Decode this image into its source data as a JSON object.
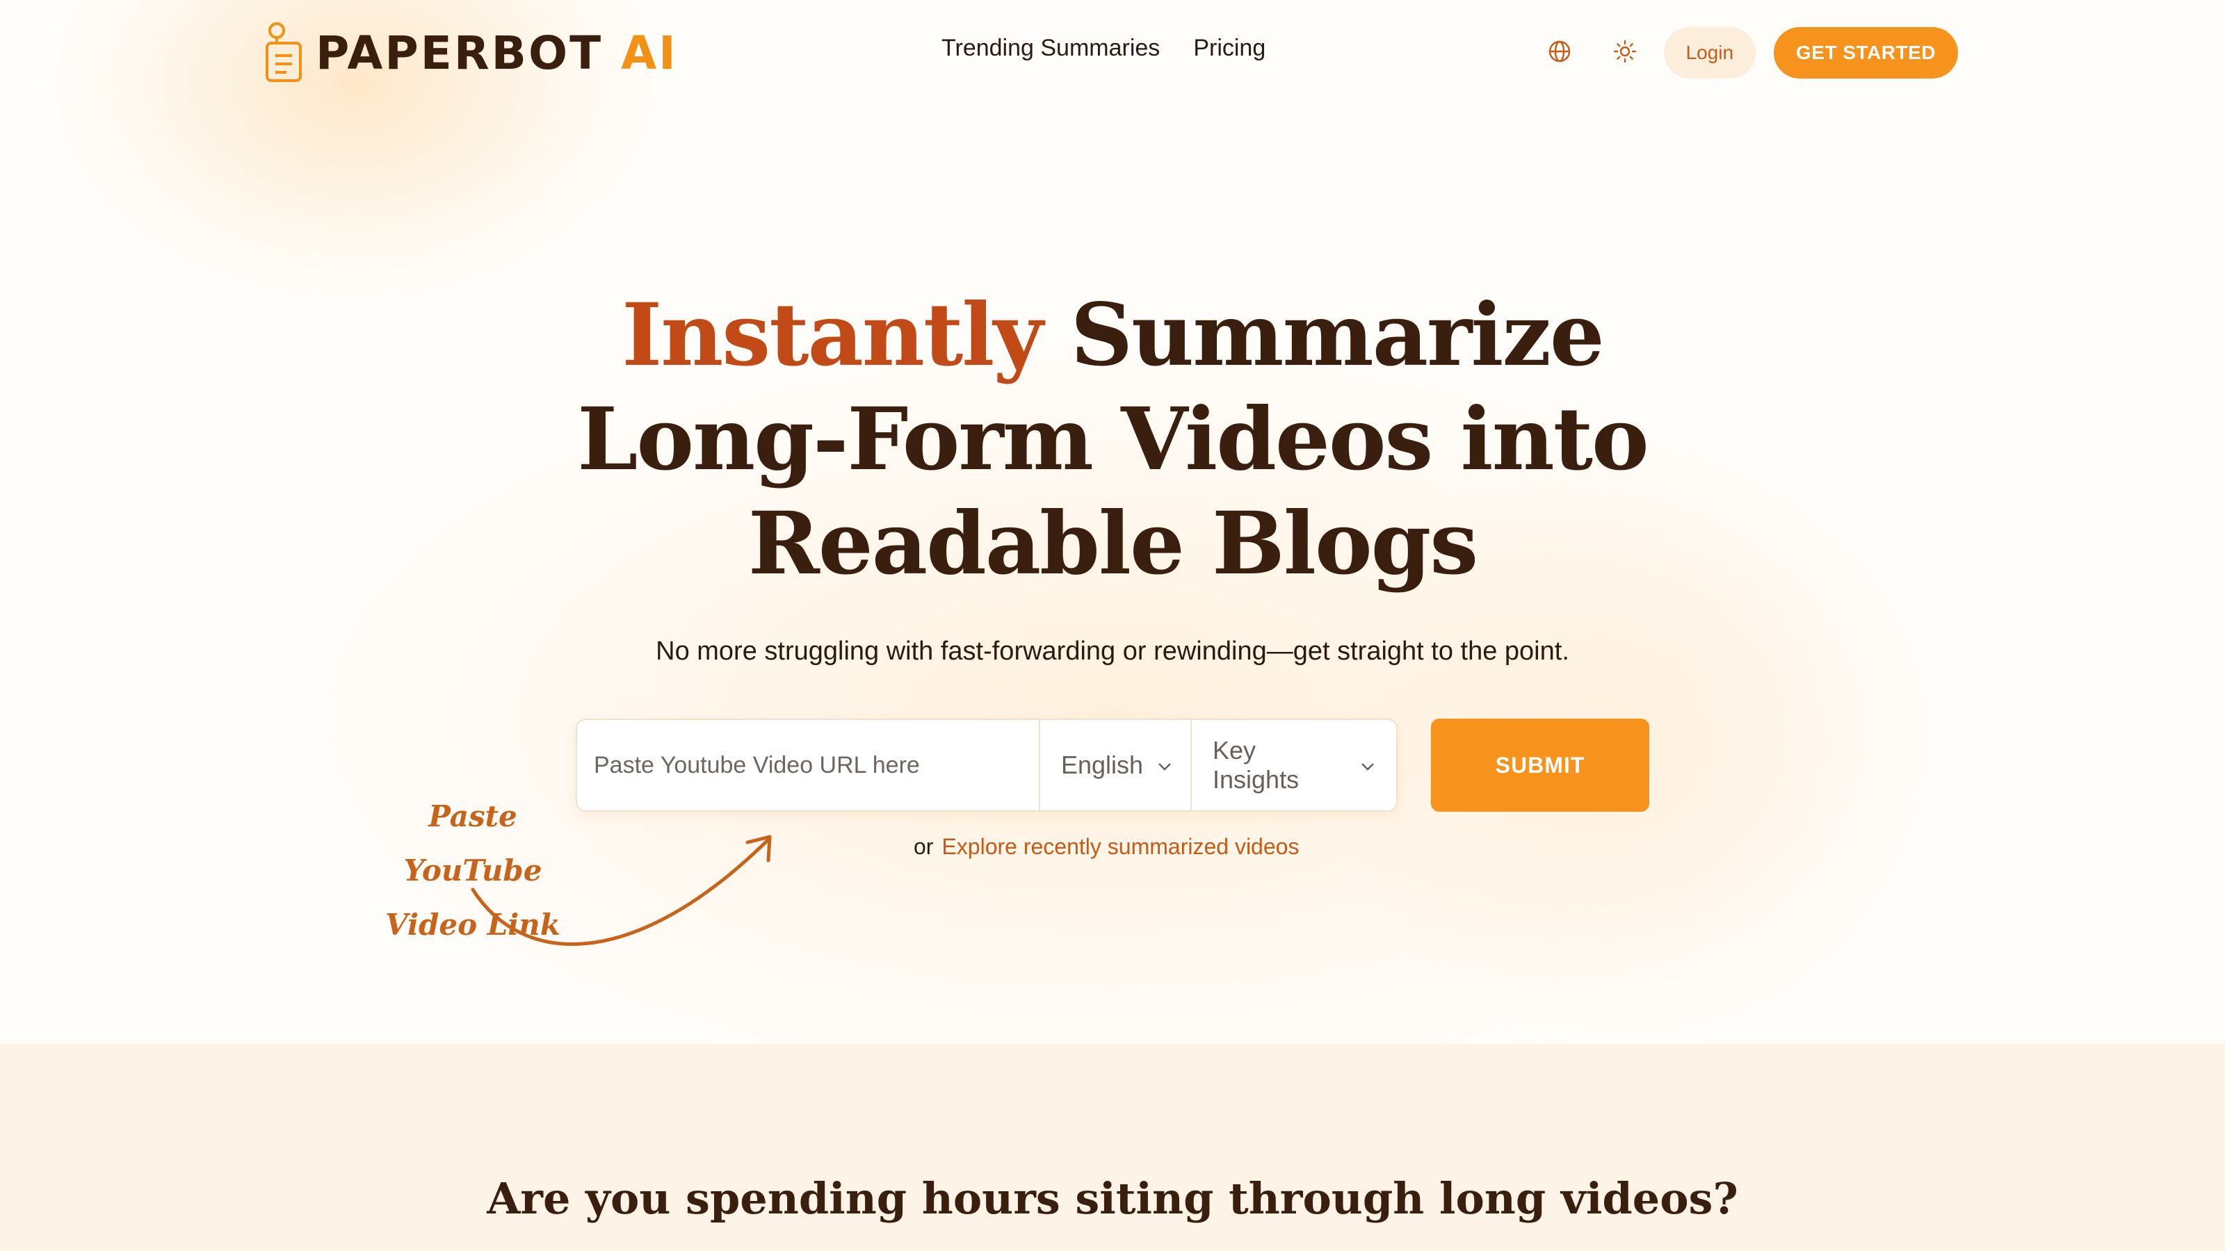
{
  "brand": {
    "name_main": "PAPERBOT",
    "name_accent": "AI",
    "logo_icon": "document-robot-icon",
    "color_primary": "#f7931c",
    "color_accent_text": "#c14a16",
    "color_dark": "#3b1f0e"
  },
  "nav": {
    "links": [
      {
        "label": "Trending Summaries"
      },
      {
        "label": "Pricing"
      }
    ],
    "language_icon": "globe-icon",
    "theme_icon": "sun-icon",
    "login_label": "Login",
    "cta_label": "GET STARTED"
  },
  "hero": {
    "title_accent": "Instantly",
    "title_rest_line1": " Summarize",
    "title_line2": "Long-Form Videos into",
    "title_line3": "Readable Blogs",
    "subtitle": "No more struggling with fast-forwarding or rewinding—get straight to the point."
  },
  "form": {
    "url_placeholder": "Paste Youtube Video URL here",
    "language_value": "English",
    "mode_value": "Key Insights",
    "chevron_icon": "chevron-down-icon",
    "submit_label": "SUBMIT",
    "or_text": "or",
    "explore_link": "Explore recently summarized videos"
  },
  "annotation": {
    "line1": "Paste YouTube",
    "line2": "Video Link",
    "arrow_icon": "curved-arrow-icon"
  },
  "section2": {
    "title": "Are you spending hours siting through long videos?"
  }
}
